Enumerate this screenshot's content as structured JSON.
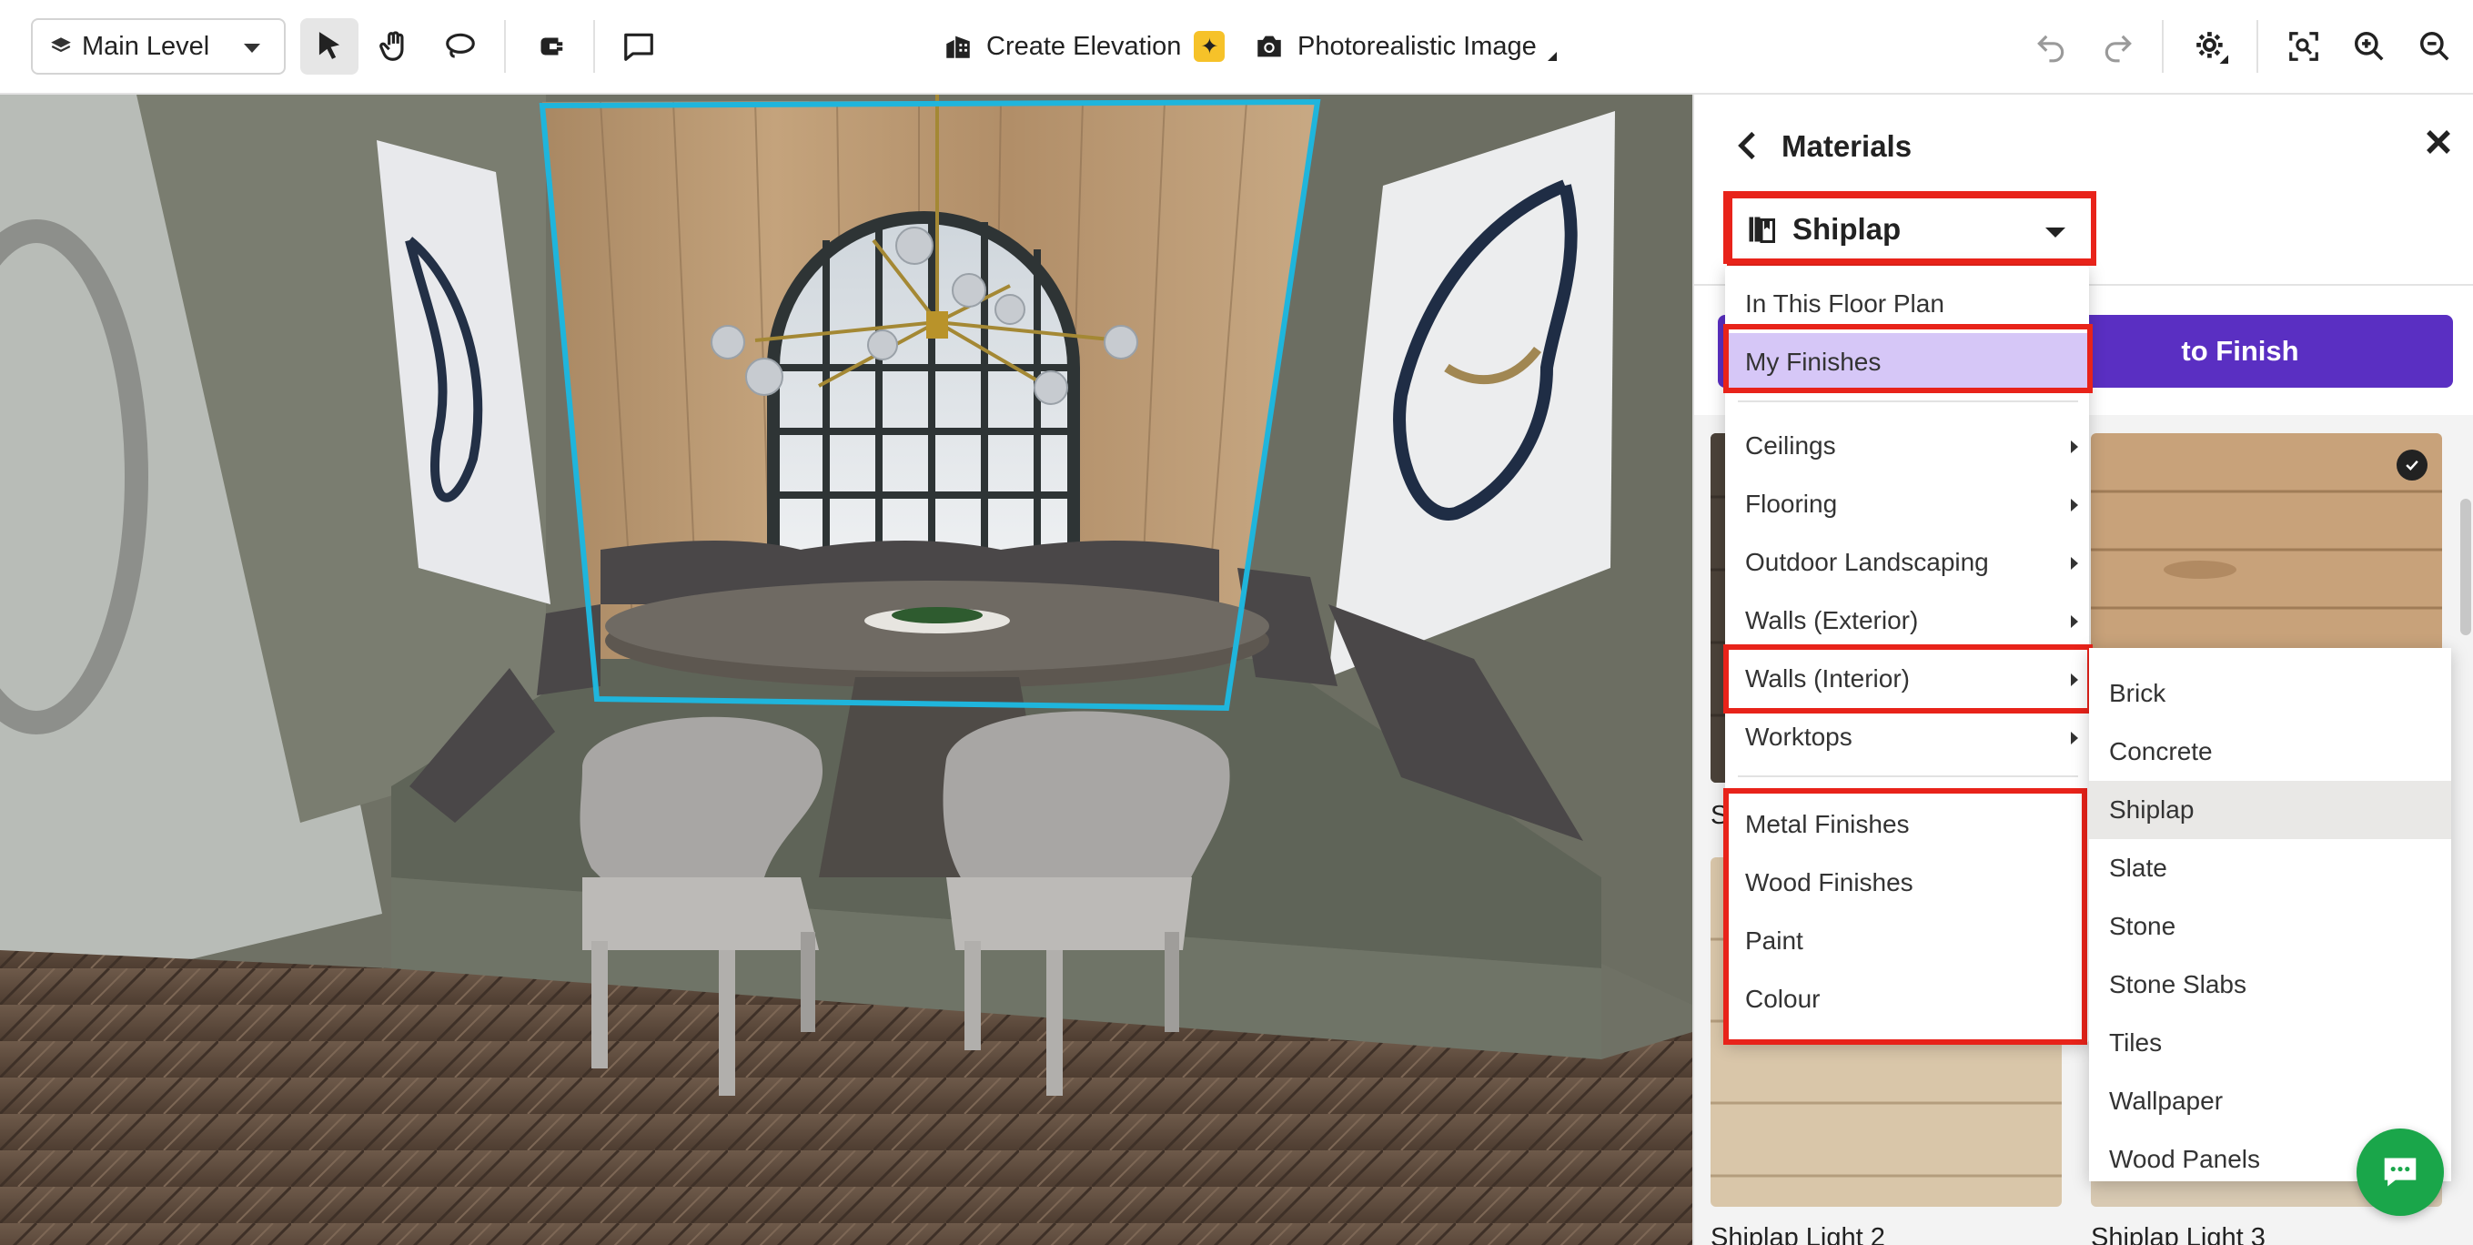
{
  "toolbar": {
    "level_select": "Main Level",
    "create_elevation": "Create Elevation",
    "photorealistic_image": "Photorealistic Image",
    "tools": [
      "select-pointer",
      "pan-hand",
      "lasso",
      "wall-tool",
      "comment"
    ],
    "right_icons": [
      "undo",
      "redo",
      "settings-gear",
      "fit-view",
      "zoom-in",
      "zoom-out"
    ]
  },
  "panel": {
    "title": "Materials",
    "library_select": "Shiplap",
    "apply_button": "to Finish",
    "tiles": [
      {
        "label": "Shiplap Light 2"
      },
      {
        "label": "Shiplap Light 3"
      }
    ],
    "partial_label_left": "S"
  },
  "dropdown": {
    "top_items": [
      {
        "label": "In This Floor Plan"
      },
      {
        "label": "My Finishes",
        "selected": true
      }
    ],
    "categories": [
      {
        "label": "Ceilings"
      },
      {
        "label": "Flooring"
      },
      {
        "label": "Outdoor Landscaping"
      },
      {
        "label": "Walls (Exterior)"
      },
      {
        "label": "Walls (Interior)"
      },
      {
        "label": "Worktops"
      }
    ],
    "finishes": [
      {
        "label": "Metal Finishes"
      },
      {
        "label": "Wood Finishes"
      },
      {
        "label": "Paint"
      },
      {
        "label": "Colour"
      }
    ]
  },
  "submenu": {
    "items": [
      {
        "label": "Brick"
      },
      {
        "label": "Concrete"
      },
      {
        "label": "Shiplap",
        "current": true
      },
      {
        "label": "Slate"
      },
      {
        "label": "Stone"
      },
      {
        "label": "Stone Slabs"
      },
      {
        "label": "Tiles"
      },
      {
        "label": "Wallpaper"
      },
      {
        "label": "Wood Panels"
      }
    ]
  },
  "colors": {
    "accent": "#5a2fc2",
    "highlight_red": "#e8231a",
    "selected_bg": "#d6c7f7",
    "chat_green": "#1aa64a",
    "selection_cyan": "#1fb5dc"
  }
}
